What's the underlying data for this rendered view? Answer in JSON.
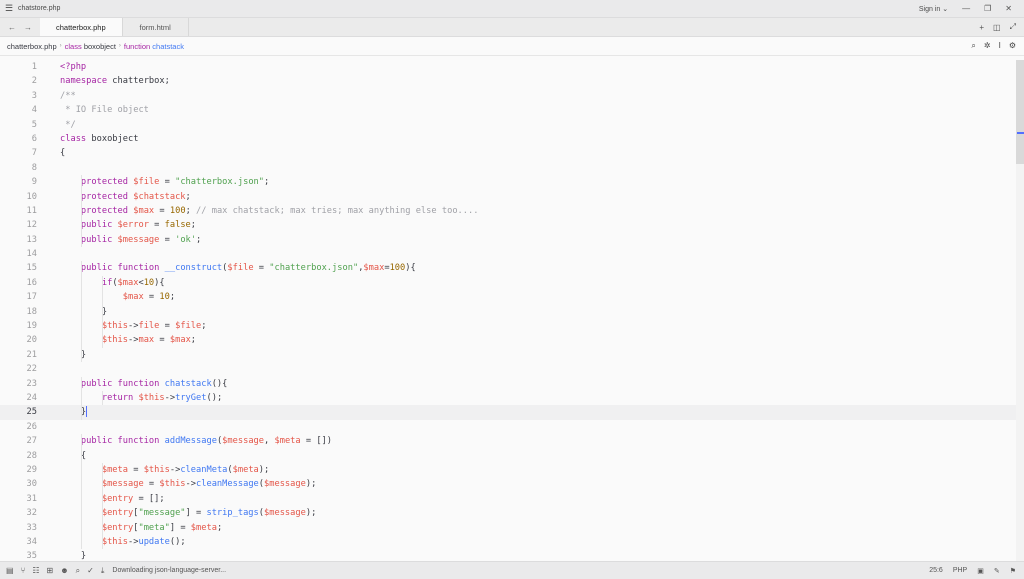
{
  "window": {
    "title": "chatstore.php",
    "sign_in": "Sign in"
  },
  "tabs": [
    {
      "label": "chatterbox.php",
      "active": true
    },
    {
      "label": "form.html",
      "active": false
    }
  ],
  "breadcrumb": {
    "file": "chatterbox.php",
    "class_kw": "class",
    "class_name": "boxobject",
    "fn_kw": "function",
    "fn_name": "chatstack"
  },
  "editor": {
    "current_line": 25,
    "line_numbers": [
      "1",
      "2",
      "3",
      "4",
      "5",
      "6",
      "7",
      "8",
      "9",
      "10",
      "11",
      "12",
      "13",
      "14",
      "15",
      "16",
      "17",
      "18",
      "19",
      "20",
      "21",
      "22",
      "23",
      "24",
      "25",
      "26",
      "27",
      "28",
      "29",
      "30",
      "31",
      "32",
      "33",
      "34",
      "35"
    ],
    "lines": [
      [
        [
          "kw",
          "<?php"
        ]
      ],
      [
        [
          "kw",
          "namespace"
        ],
        [
          "pl",
          " chatterbox;"
        ]
      ],
      [
        [
          "com",
          "/**"
        ]
      ],
      [
        [
          "com",
          " * IO File object"
        ]
      ],
      [
        [
          "com",
          " */"
        ]
      ],
      [
        [
          "kw",
          "class"
        ],
        [
          "pl",
          " boxobject"
        ]
      ],
      [
        [
          "pl",
          "{"
        ]
      ],
      [],
      [
        [
          "pl",
          "    "
        ],
        [
          "kw",
          "protected"
        ],
        [
          "pl",
          " "
        ],
        [
          "var",
          "$file"
        ],
        [
          "pl",
          " = "
        ],
        [
          "str",
          "\"chatterbox.json\""
        ],
        [
          "pl",
          ";"
        ]
      ],
      [
        [
          "pl",
          "    "
        ],
        [
          "kw",
          "protected"
        ],
        [
          "pl",
          " "
        ],
        [
          "var",
          "$chatstack"
        ],
        [
          "pl",
          ";"
        ]
      ],
      [
        [
          "pl",
          "    "
        ],
        [
          "kw",
          "protected"
        ],
        [
          "pl",
          " "
        ],
        [
          "var",
          "$max"
        ],
        [
          "pl",
          " = "
        ],
        [
          "num",
          "100"
        ],
        [
          "pl",
          "; "
        ],
        [
          "com",
          "// max chatstack; max tries; max anything else too...."
        ]
      ],
      [
        [
          "pl",
          "    "
        ],
        [
          "kw",
          "public"
        ],
        [
          "pl",
          " "
        ],
        [
          "var",
          "$error"
        ],
        [
          "pl",
          " = "
        ],
        [
          "num",
          "false"
        ],
        [
          "pl",
          ";"
        ]
      ],
      [
        [
          "pl",
          "    "
        ],
        [
          "kw",
          "public"
        ],
        [
          "pl",
          " "
        ],
        [
          "var",
          "$message"
        ],
        [
          "pl",
          " = "
        ],
        [
          "str",
          "'ok'"
        ],
        [
          "pl",
          ";"
        ]
      ],
      [],
      [
        [
          "pl",
          "    "
        ],
        [
          "kw",
          "public function"
        ],
        [
          "pl",
          " "
        ],
        [
          "fn",
          "__construct"
        ],
        [
          "pl",
          "("
        ],
        [
          "var",
          "$file"
        ],
        [
          "pl",
          " = "
        ],
        [
          "str",
          "\"chatterbox.json\""
        ],
        [
          "pl",
          ","
        ],
        [
          "var",
          "$max"
        ],
        [
          "pl",
          "="
        ],
        [
          "num",
          "100"
        ],
        [
          "pl",
          "){"
        ]
      ],
      [
        [
          "pl",
          "        "
        ],
        [
          "kw",
          "if"
        ],
        [
          "pl",
          "("
        ],
        [
          "var",
          "$max"
        ],
        [
          "pl",
          "<"
        ],
        [
          "num",
          "10"
        ],
        [
          "pl",
          "){"
        ]
      ],
      [
        [
          "pl",
          "            "
        ],
        [
          "var",
          "$max"
        ],
        [
          "pl",
          " = "
        ],
        [
          "num",
          "10"
        ],
        [
          "pl",
          ";"
        ]
      ],
      [
        [
          "pl",
          "        }"
        ]
      ],
      [
        [
          "pl",
          "        "
        ],
        [
          "var",
          "$this"
        ],
        [
          "pl",
          "->"
        ],
        [
          "prop",
          "file"
        ],
        [
          "pl",
          " = "
        ],
        [
          "var",
          "$file"
        ],
        [
          "pl",
          ";"
        ]
      ],
      [
        [
          "pl",
          "        "
        ],
        [
          "var",
          "$this"
        ],
        [
          "pl",
          "->"
        ],
        [
          "prop",
          "max"
        ],
        [
          "pl",
          " = "
        ],
        [
          "var",
          "$max"
        ],
        [
          "pl",
          ";"
        ]
      ],
      [
        [
          "pl",
          "    }"
        ]
      ],
      [],
      [
        [
          "pl",
          "    "
        ],
        [
          "kw",
          "public function"
        ],
        [
          "pl",
          " "
        ],
        [
          "fn",
          "chatstack"
        ],
        [
          "pl",
          "(){"
        ]
      ],
      [
        [
          "pl",
          "        "
        ],
        [
          "kw",
          "return"
        ],
        [
          "pl",
          " "
        ],
        [
          "var",
          "$this"
        ],
        [
          "pl",
          "->"
        ],
        [
          "fn",
          "tryGet"
        ],
        [
          "pl",
          "();"
        ]
      ],
      [
        [
          "pl",
          "    }"
        ]
      ],
      [],
      [
        [
          "pl",
          "    "
        ],
        [
          "kw",
          "public function"
        ],
        [
          "pl",
          " "
        ],
        [
          "fn",
          "addMessage"
        ],
        [
          "pl",
          "("
        ],
        [
          "var",
          "$message"
        ],
        [
          "pl",
          ", "
        ],
        [
          "var",
          "$meta"
        ],
        [
          "pl",
          " = [])"
        ]
      ],
      [
        [
          "pl",
          "    {"
        ]
      ],
      [
        [
          "pl",
          "        "
        ],
        [
          "var",
          "$meta"
        ],
        [
          "pl",
          " = "
        ],
        [
          "var",
          "$this"
        ],
        [
          "pl",
          "->"
        ],
        [
          "fn",
          "cleanMeta"
        ],
        [
          "pl",
          "("
        ],
        [
          "var",
          "$meta"
        ],
        [
          "pl",
          ");"
        ]
      ],
      [
        [
          "pl",
          "        "
        ],
        [
          "var",
          "$message"
        ],
        [
          "pl",
          " = "
        ],
        [
          "var",
          "$this"
        ],
        [
          "pl",
          "->"
        ],
        [
          "fn",
          "cleanMessage"
        ],
        [
          "pl",
          "("
        ],
        [
          "var",
          "$message"
        ],
        [
          "pl",
          ");"
        ]
      ],
      [
        [
          "pl",
          "        "
        ],
        [
          "var",
          "$entry"
        ],
        [
          "pl",
          " = [];"
        ]
      ],
      [
        [
          "pl",
          "        "
        ],
        [
          "var",
          "$entry"
        ],
        [
          "pl",
          "["
        ],
        [
          "str",
          "\"message\""
        ],
        [
          "pl",
          "] = "
        ],
        [
          "fn",
          "strip_tags"
        ],
        [
          "pl",
          "("
        ],
        [
          "var",
          "$message"
        ],
        [
          "pl",
          ");"
        ]
      ],
      [
        [
          "pl",
          "        "
        ],
        [
          "var",
          "$entry"
        ],
        [
          "pl",
          "["
        ],
        [
          "str",
          "\"meta\""
        ],
        [
          "pl",
          "] = "
        ],
        [
          "var",
          "$meta"
        ],
        [
          "pl",
          ";"
        ]
      ],
      [
        [
          "pl",
          "        "
        ],
        [
          "var",
          "$this"
        ],
        [
          "pl",
          "->"
        ],
        [
          "fn",
          "update"
        ],
        [
          "pl",
          "();"
        ]
      ],
      [
        [
          "pl",
          "    }"
        ]
      ]
    ]
  },
  "statusbar": {
    "message": "Downloading json-language-server...",
    "cursor_position": "25:6",
    "language": "PHP"
  },
  "icons": {
    "menu": "hamburger-icon",
    "back": "arrow-left-icon",
    "forward": "arrow-right-icon",
    "add": "plus-icon",
    "split": "split-pane-icon",
    "zoom": "zoom-icon",
    "search": "search-icon"
  }
}
